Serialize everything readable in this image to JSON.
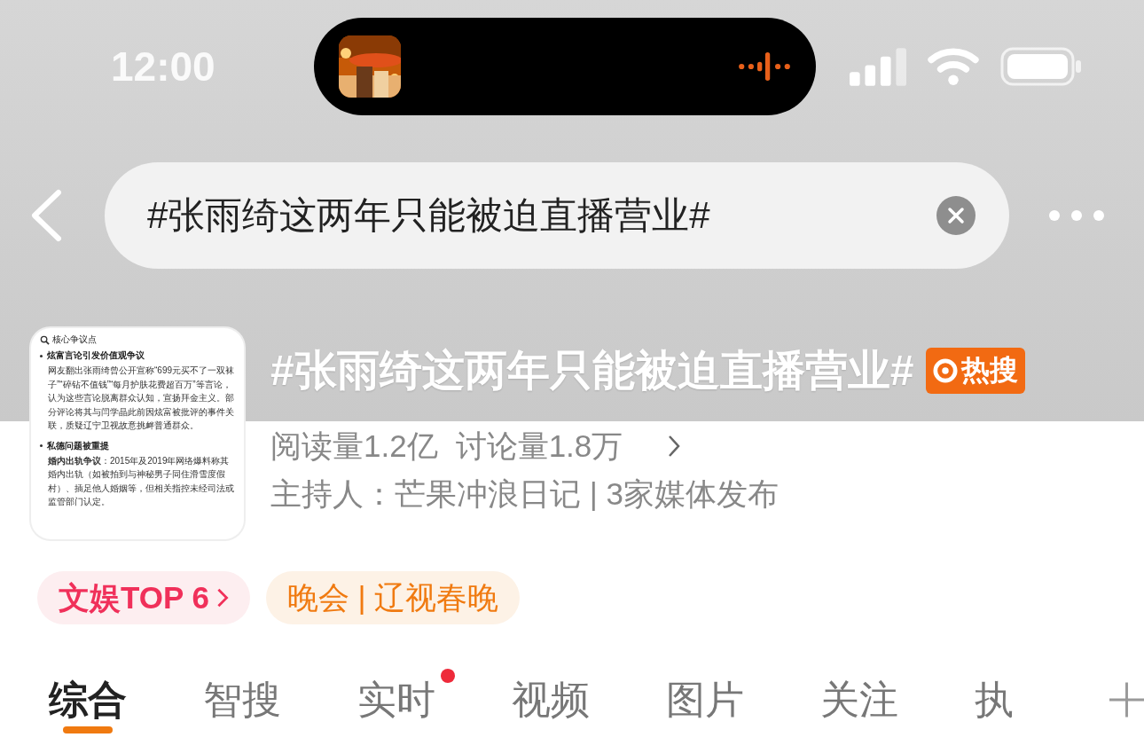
{
  "status_bar": {
    "time": "12:00"
  },
  "search": {
    "value": "#张雨绮这两年只能被迫直播营业#"
  },
  "topic": {
    "title": "#张雨绮这两年只能被迫直播营业#",
    "badge": "热搜",
    "thumbnail": {
      "heading": "核心争议点",
      "sections": [
        {
          "title": "炫富言论引发价值观争议",
          "body": "网友翻出张雨绮曾公开宣称“699元买不了一双袜子”“碎钻不值钱”“每月护肤花费超百万”等言论，认为这些言论脱离群众认知，宣扬拜金主义。部分评论将其与闫学晶此前因炫富被批评的事件关联，质疑辽宁卫视故意挑衅普通群众。"
        },
        {
          "title": "私德问题被重提",
          "body": "**婚内出轨争议**：2015年及2019年网络爆料称其婚内出轨（如被拍到与神秘男子同住滑雪度假村）、插足他人婚姻等，但相关指控未经司法或监管部门认定。"
        }
      ]
    },
    "reads": "阅读量1.2亿",
    "discussions": "讨论量1.8万",
    "host": "主持人：芒果冲浪日记 | 3家媒体发布"
  },
  "tags": [
    {
      "label": "文娱TOP 6",
      "kind": "rank"
    },
    {
      "label": "晚会 | 辽视春晚",
      "kind": "event"
    }
  ],
  "tabs": [
    {
      "label": "综合",
      "selected": true,
      "dot": false
    },
    {
      "label": "智搜",
      "selected": false,
      "dot": false
    },
    {
      "label": "实时",
      "selected": false,
      "dot": true
    },
    {
      "label": "视频",
      "selected": false,
      "dot": false
    },
    {
      "label": "图片",
      "selected": false,
      "dot": false
    },
    {
      "label": "关注",
      "selected": false,
      "dot": false
    },
    {
      "label": "执",
      "selected": false,
      "dot": false
    }
  ]
}
